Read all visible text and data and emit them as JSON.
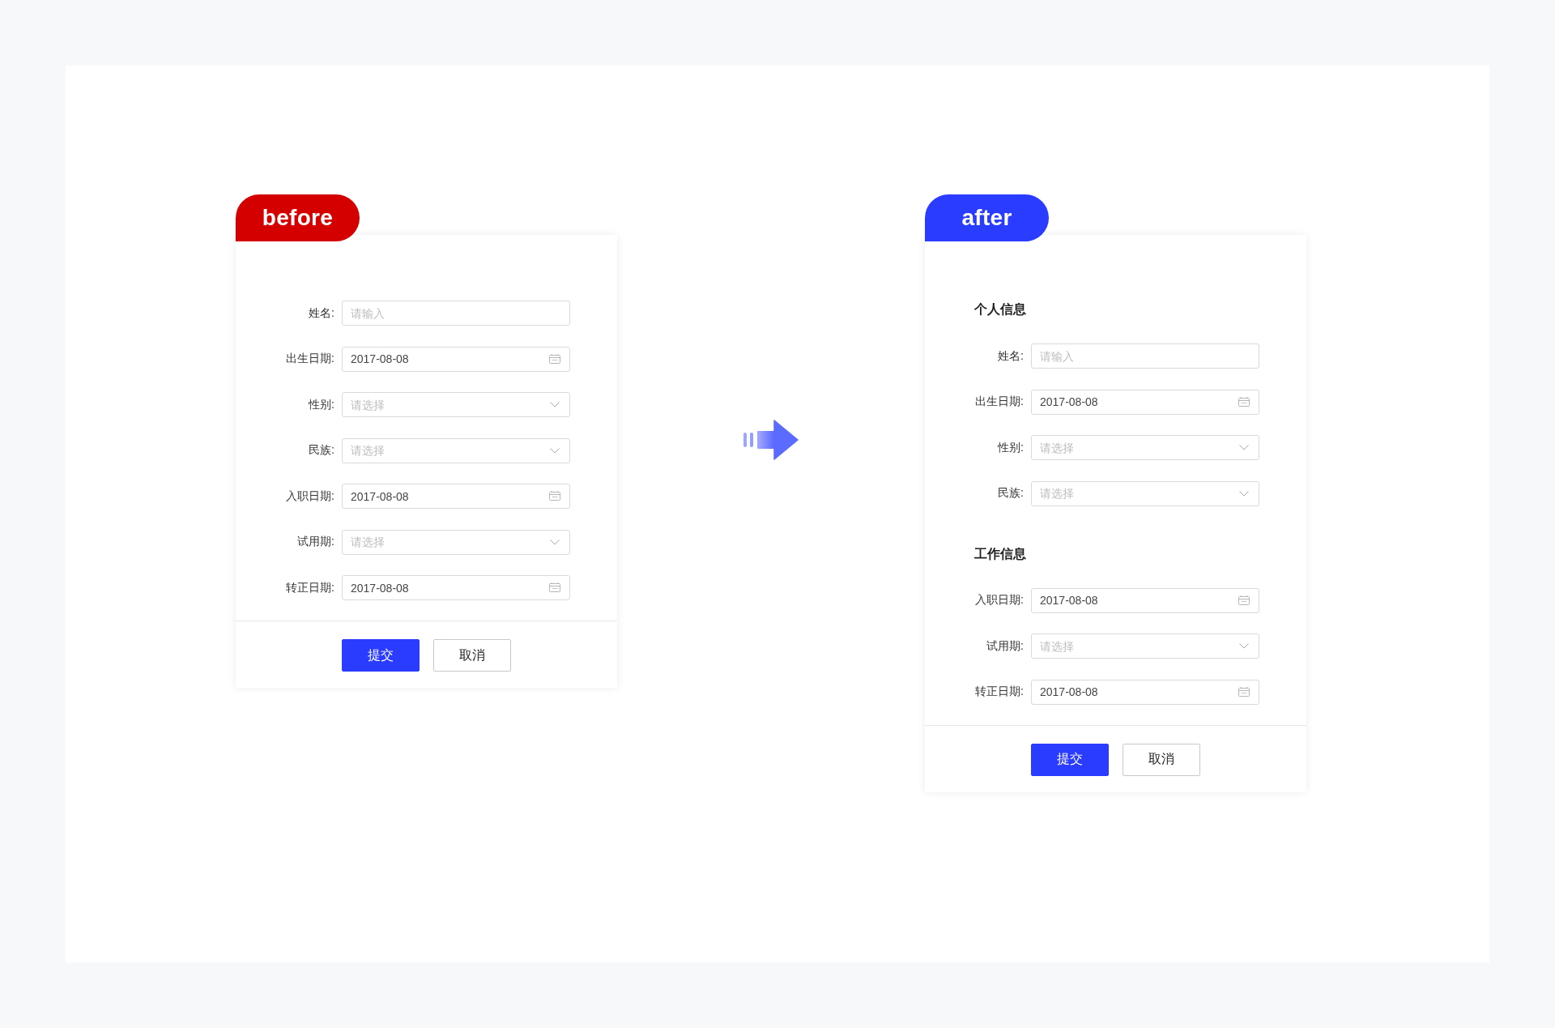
{
  "panels": [
    {
      "badge": {
        "text": "before",
        "color": "#d40000"
      },
      "sections": [
        {
          "fields": [
            {
              "label": "姓名:",
              "kind": "text",
              "placeholder": "请输入"
            },
            {
              "label": "出生日期:",
              "kind": "date",
              "value": "2017-08-08"
            },
            {
              "label": "性别:",
              "kind": "select",
              "placeholder": "请选择"
            },
            {
              "label": "民族:",
              "kind": "select",
              "placeholder": "请选择"
            },
            {
              "label": "入职日期:",
              "kind": "date",
              "value": "2017-08-08"
            },
            {
              "label": "试用期:",
              "kind": "select",
              "placeholder": "请选择"
            },
            {
              "label": "转正日期:",
              "kind": "date",
              "value": "2017-08-08"
            }
          ]
        }
      ],
      "buttons": [
        {
          "label": "提交",
          "kind": "primary"
        },
        {
          "label": "取消",
          "kind": "default"
        }
      ]
    },
    {
      "badge": {
        "text": "after",
        "color": "#2a3cff"
      },
      "sections": [
        {
          "title": "个人信息",
          "fields": [
            {
              "label": "姓名:",
              "kind": "text",
              "placeholder": "请输入"
            },
            {
              "label": "出生日期:",
              "kind": "date",
              "value": "2017-08-08"
            },
            {
              "label": "性别:",
              "kind": "select",
              "placeholder": "请选择"
            },
            {
              "label": "民族:",
              "kind": "select",
              "placeholder": "请选择"
            }
          ]
        },
        {
          "title": "工作信息",
          "fields": [
            {
              "label": "入职日期:",
              "kind": "date",
              "value": "2017-08-08"
            },
            {
              "label": "试用期:",
              "kind": "select",
              "placeholder": "请选择"
            },
            {
              "label": "转正日期:",
              "kind": "date",
              "value": "2017-08-08"
            }
          ]
        }
      ],
      "buttons": [
        {
          "label": "提交",
          "kind": "primary"
        },
        {
          "label": "取消",
          "kind": "default"
        }
      ]
    }
  ]
}
